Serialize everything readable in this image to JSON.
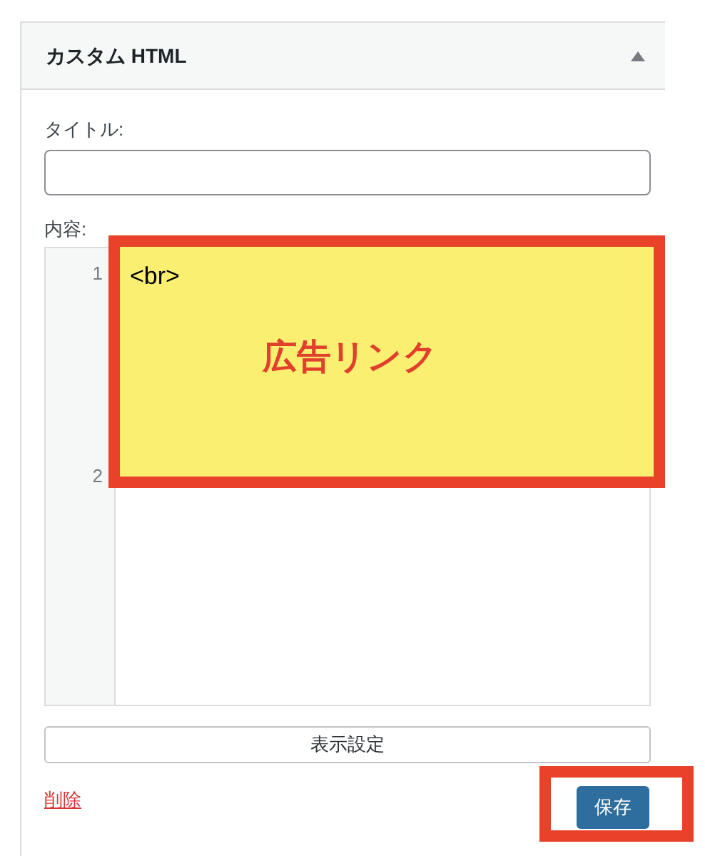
{
  "widget": {
    "title": "カスタム HTML",
    "expanded": true
  },
  "title_field": {
    "label": "タイトル:"
  },
  "content_field": {
    "label": "内容:",
    "line_numbers": [
      "1",
      "2"
    ]
  },
  "annotation": {
    "code": "<br>",
    "callout": "広告リンク"
  },
  "visibility_button": "表示設定",
  "delete_link": "削除",
  "save_button": "保存"
}
